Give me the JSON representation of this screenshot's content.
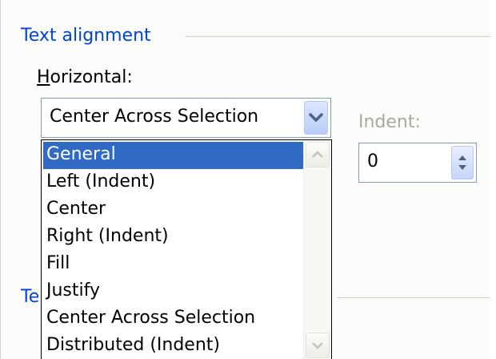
{
  "section": {
    "text_alignment_title": "Text alignment",
    "text_control_title_fragment": "Te"
  },
  "horizontal": {
    "label_accesskey": "H",
    "label_rest": "orizontal:",
    "value": "Center Across Selection",
    "options": [
      "General",
      "Left (Indent)",
      "Center",
      "Right (Indent)",
      "Fill",
      "Justify",
      "Center Across Selection",
      "Distributed (Indent)"
    ],
    "highlighted_option": "General"
  },
  "indent": {
    "label": "Indent:",
    "value": "0"
  },
  "colors": {
    "group_title": "#0046d5",
    "highlight": "#316ac5",
    "disabled_text": "#aca899",
    "field_border": "#7f9db9"
  }
}
